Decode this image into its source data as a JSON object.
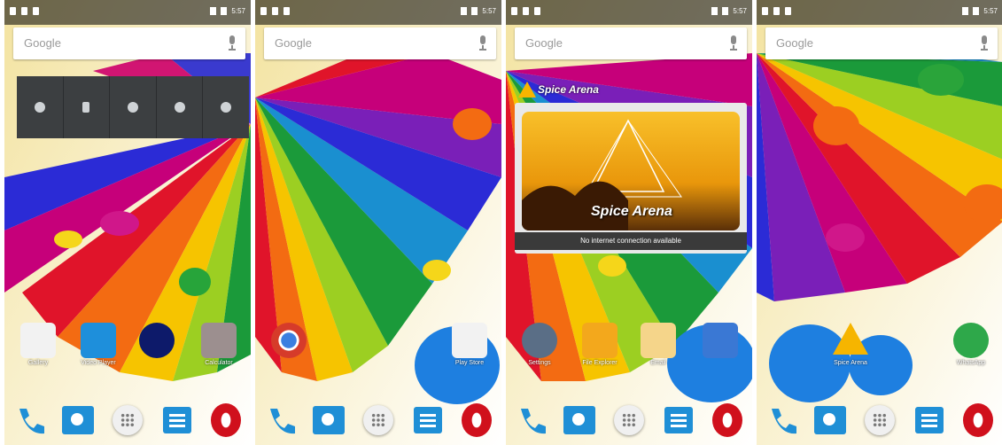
{
  "colors": {
    "statusbar": "#000000",
    "search_bg": "#ffffff",
    "toggle_panel": "#3c3f41",
    "dock_blue": "#1f8fd6",
    "opera_red": "#d0101c",
    "widget_yellow": "#f6b500"
  },
  "screens": [
    {
      "status": {
        "time": "5:57"
      },
      "search": {
        "label": "Google"
      },
      "toggles": [
        "wifi-icon",
        "bluetooth-icon",
        "location-icon",
        "sync-icon",
        "airplane-icon"
      ],
      "apps": [
        {
          "name": "chrome-like-icon",
          "label": "Gallery"
        },
        {
          "name": "video-icon",
          "label": "Video Player"
        },
        {
          "name": "camera-icon",
          "label": ""
        },
        {
          "name": "calculator-icon",
          "label": "Calculator"
        }
      ],
      "dock": [
        "phone",
        "contacts",
        "app-drawer",
        "messaging",
        "opera"
      ]
    },
    {
      "status": {
        "time": "5:57"
      },
      "search": {
        "label": "Google"
      },
      "apps": [
        {
          "name": "chrome-icon",
          "label": ""
        },
        {
          "name": "play-store-icon",
          "label": "Play Store"
        }
      ],
      "dock": [
        "phone",
        "contacts",
        "app-drawer",
        "messaging",
        "opera"
      ]
    },
    {
      "status": {
        "time": "5:57"
      },
      "search": {
        "label": "Google"
      },
      "widget": {
        "title": "Spice Arena",
        "banner": "Spice Arena",
        "caption": "No internet connection available"
      },
      "apps": [
        {
          "name": "settings-icon",
          "label": "Settings"
        },
        {
          "name": "folder-icon",
          "label": "File Explorer"
        },
        {
          "name": "email-icon",
          "label": "Email"
        },
        {
          "name": "calendar-icon",
          "label": ""
        }
      ],
      "dock": [
        "phone",
        "contacts",
        "app-drawer",
        "messaging",
        "opera"
      ]
    },
    {
      "status": {
        "time": "5:57"
      },
      "search": {
        "label": "Google"
      },
      "apps": [
        {
          "name": "spice-arena-icon",
          "label": "Spice Arena"
        },
        {
          "name": "whatsapp-icon",
          "label": "WhatsApp"
        }
      ],
      "dock": [
        "phone",
        "contacts",
        "app-drawer",
        "messaging",
        "opera"
      ]
    }
  ]
}
